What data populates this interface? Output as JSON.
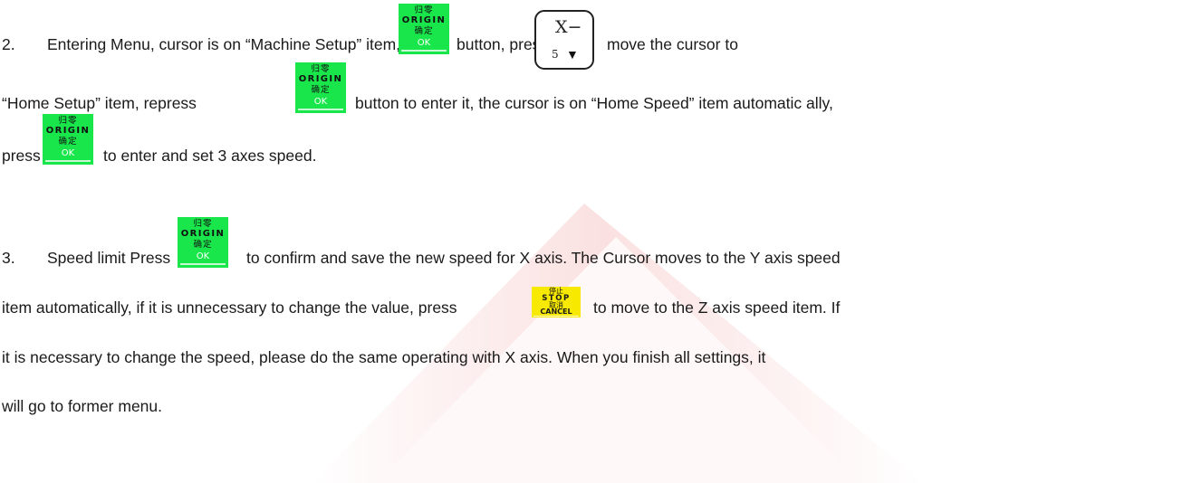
{
  "keys": {
    "ok": {
      "line1": "归零",
      "line2": "ORIGIN",
      "line3": "确定",
      "line4": "OK",
      "color": "#19e64b"
    },
    "stop": {
      "line1": "停止",
      "line2": "STOP",
      "line3": "取消",
      "line4": "CANCEL",
      "color": "#f7ea00"
    },
    "xminus": {
      "label": "X−",
      "number": "5",
      "arrow": "▼"
    }
  },
  "step2": {
    "number": "2.",
    "l1_a": "Entering Menu, cursor is on “Machine Setup” item, press",
    "l1_b": "button, press",
    "l1_c": "move the cursor to",
    "l2_a": "“Home Setup” item, repress",
    "l2_b": "button to enter it, the cursor is on “Home Speed” item automatic ally,",
    "l3_a": "press",
    "l3_b": "to enter and set 3 axes speed."
  },
  "step3": {
    "number": "3.",
    "l1_a": "Speed limit Press",
    "l1_b": "to confirm and save the new speed for X axis. The Cursor moves to the Y axis speed",
    "l2_a": "item automatically, if it is unnecessary to change the value, press",
    "l2_b": "to move to the Z axis speed item. If",
    "l3": "it is necessary to change the speed, please do the same operating with X axis. When you finish all settings, it",
    "l4": "will go to former menu."
  }
}
